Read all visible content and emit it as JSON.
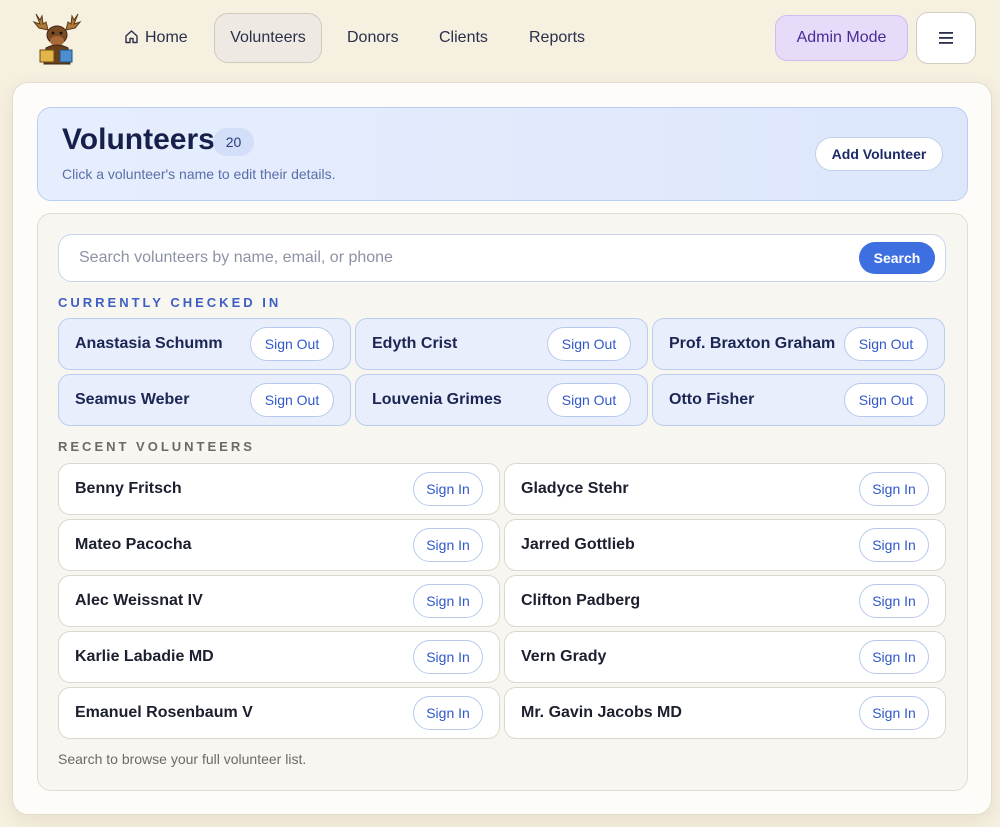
{
  "nav": {
    "home": "Home",
    "volunteers": "Volunteers",
    "donors": "Donors",
    "clients": "Clients",
    "reports": "Reports",
    "admin": "Admin Mode",
    "menu_icon": "≡"
  },
  "header": {
    "title": "Volunteers",
    "count": "20",
    "subtitle": "Click a volunteer's name to edit their details.",
    "add_label": "Add Volunteer"
  },
  "search": {
    "placeholder": "Search volunteers by name, email, or phone",
    "value": "",
    "button": "Search"
  },
  "checked_in": {
    "label": "CURRENTLY CHECKED IN",
    "people": [
      {
        "name": "Anastasia Schumm",
        "action": "Sign Out"
      },
      {
        "name": "Edyth Crist",
        "action": "Sign Out"
      },
      {
        "name": "Prof. Braxton Graham",
        "action": "Sign Out"
      },
      {
        "name": "Seamus Weber",
        "action": "Sign Out"
      },
      {
        "name": "Louvenia Grimes",
        "action": "Sign Out"
      },
      {
        "name": "Otto Fisher",
        "action": "Sign Out"
      }
    ]
  },
  "recent": {
    "label": "RECENT VOLUNTEERS",
    "people": [
      {
        "name": "Benny Fritsch",
        "action": "Sign In"
      },
      {
        "name": "Gladyce Stehr",
        "action": "Sign In"
      },
      {
        "name": "Mateo Pacocha",
        "action": "Sign In"
      },
      {
        "name": "Jarred Gottlieb",
        "action": "Sign In"
      },
      {
        "name": "Alec Weissnat IV",
        "action": "Sign In"
      },
      {
        "name": "Clifton Padberg",
        "action": "Sign In"
      },
      {
        "name": "Karlie Labadie MD",
        "action": "Sign In"
      },
      {
        "name": "Vern Grady",
        "action": "Sign In"
      },
      {
        "name": "Emanuel Rosenbaum V",
        "action": "Sign In"
      },
      {
        "name": "Mr. Gavin Jacobs MD",
        "action": "Sign In"
      }
    ]
  },
  "footnote": "Search to browse your full volunteer list.",
  "colors": {
    "accent": "#3d6fe0",
    "admin_bg": "#e6dcf9",
    "checked_bg": "#e8eefb",
    "page_bg": "#f6f0e1"
  },
  "icons": {
    "logo": "moose-mascot-logo",
    "home": "home-icon",
    "menu": "hamburger-menu-icon"
  }
}
